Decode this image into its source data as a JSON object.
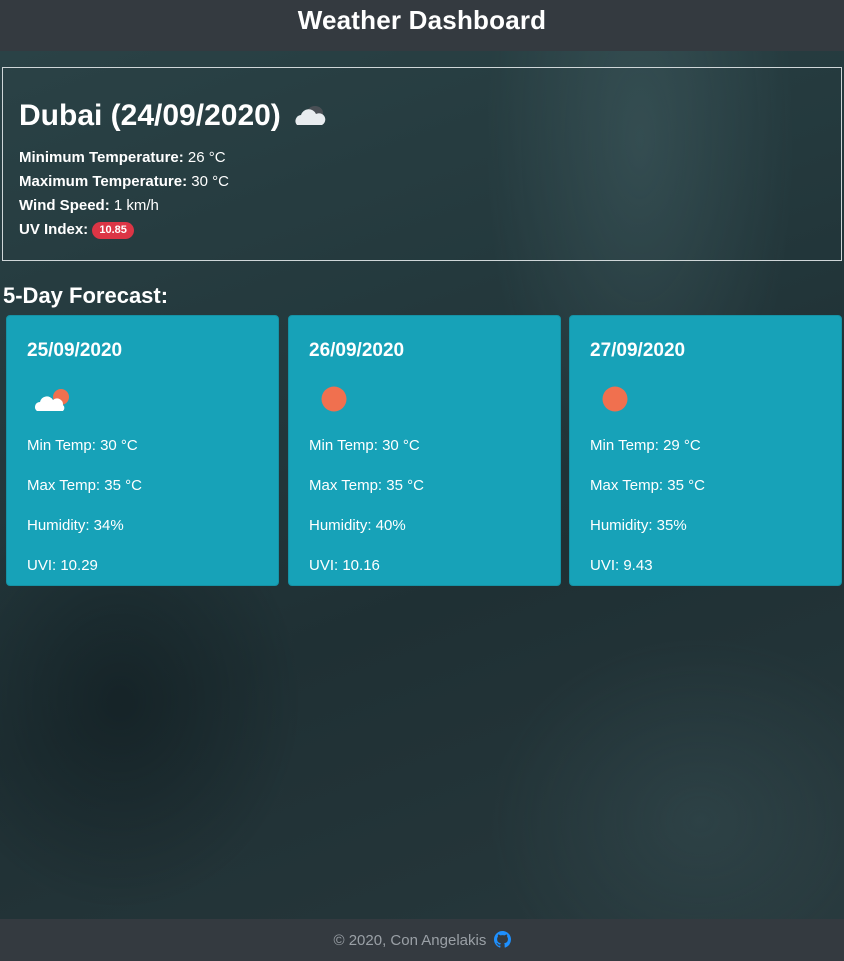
{
  "header": {
    "title": "Weather Dashboard"
  },
  "current": {
    "heading": "Dubai (24/09/2020)",
    "icon": "cloud-icon",
    "min_temp_label": "Minimum Temperature:",
    "min_temp_value": " 26 °C",
    "max_temp_label": "Maximum Temperature:",
    "max_temp_value": " 30 °C",
    "wind_label": "Wind Speed:",
    "wind_value": " 1 km/h",
    "uv_label": "UV Index:",
    "uv_value": "10.85",
    "uv_color": "#dc3545"
  },
  "forecast": {
    "title": "5-Day Forecast:",
    "card_color": "#17a2b8",
    "days": [
      {
        "date": "25/09/2020",
        "icon": "partly-cloudy-icon",
        "min": "Min Temp: 30 °C",
        "max": "Max Temp: 35 °C",
        "humidity": "Humidity: 34%",
        "uvi": "UVI: 10.29"
      },
      {
        "date": "26/09/2020",
        "icon": "sun-icon",
        "min": "Min Temp: 30 °C",
        "max": "Max Temp: 35 °C",
        "humidity": "Humidity: 40%",
        "uvi": "UVI: 10.16"
      },
      {
        "date": "27/09/2020",
        "icon": "sun-icon",
        "min": "Min Temp: 29 °C",
        "max": "Max Temp: 35 °C",
        "humidity": "Humidity: 35%",
        "uvi": "UVI: 9.43"
      }
    ]
  },
  "footer": {
    "text": "© 2020, Con Angelakis",
    "icon": "github-icon",
    "icon_color": "#1e90ff"
  }
}
